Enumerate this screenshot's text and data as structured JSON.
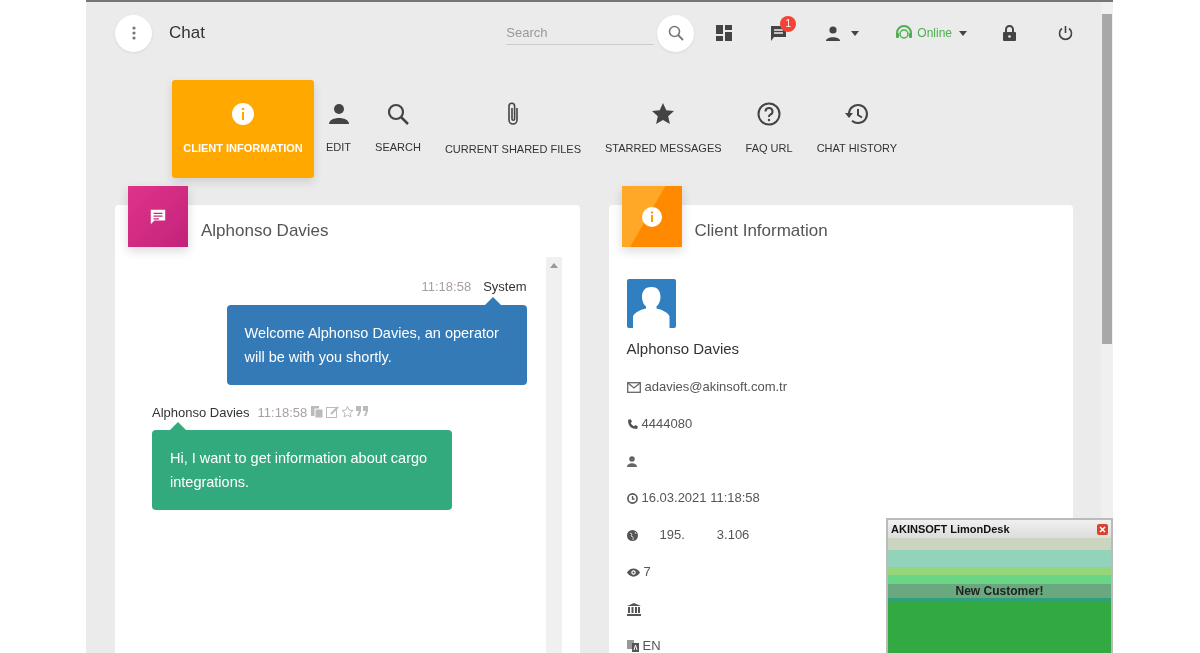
{
  "header": {
    "title": "Chat",
    "search": {
      "placeholder": "Search"
    },
    "notification_count": "1",
    "status": "Online"
  },
  "tabs": [
    {
      "label": "CLIENT INFORMATION",
      "selected": true
    },
    {
      "label": "EDIT",
      "selected": false
    },
    {
      "label": "SEARCH",
      "selected": false
    },
    {
      "label": "CURRENT SHARED FILES",
      "selected": false
    },
    {
      "label": "STARRED MESSAGES",
      "selected": false
    },
    {
      "label": "FAQ URL",
      "selected": false
    },
    {
      "label": "CHAT HISTORY",
      "selected": false
    }
  ],
  "chat": {
    "title": "Alphonso Davies",
    "messages": [
      {
        "kind": "system",
        "sender": "System",
        "time": "11:18:58",
        "text": "Welcome Alphonso Davies, an operator will be with you shortly."
      },
      {
        "kind": "visitor",
        "sender": "Alphonso Davies",
        "time": "11:18:58",
        "text": "Hi, I want to get information about cargo integrations."
      }
    ]
  },
  "client": {
    "title": "Client Information",
    "name": "Alphonso Davies",
    "details": [
      {
        "kind": "email",
        "text": "adavies@akinsoft.com.tr"
      },
      {
        "kind": "phone",
        "text": "4444080"
      },
      {
        "kind": "user"
      },
      {
        "kind": "time",
        "text": "16.03.2021 11:18:58"
      },
      {
        "kind": "ip",
        "parts": [
          "195.",
          "3.106"
        ]
      },
      {
        "kind": "views",
        "text": "7"
      },
      {
        "kind": "institution"
      },
      {
        "kind": "language",
        "text": "EN"
      }
    ]
  },
  "popup": {
    "title": "AKINSOFT LimonDesk",
    "message": "New Customer!"
  }
}
